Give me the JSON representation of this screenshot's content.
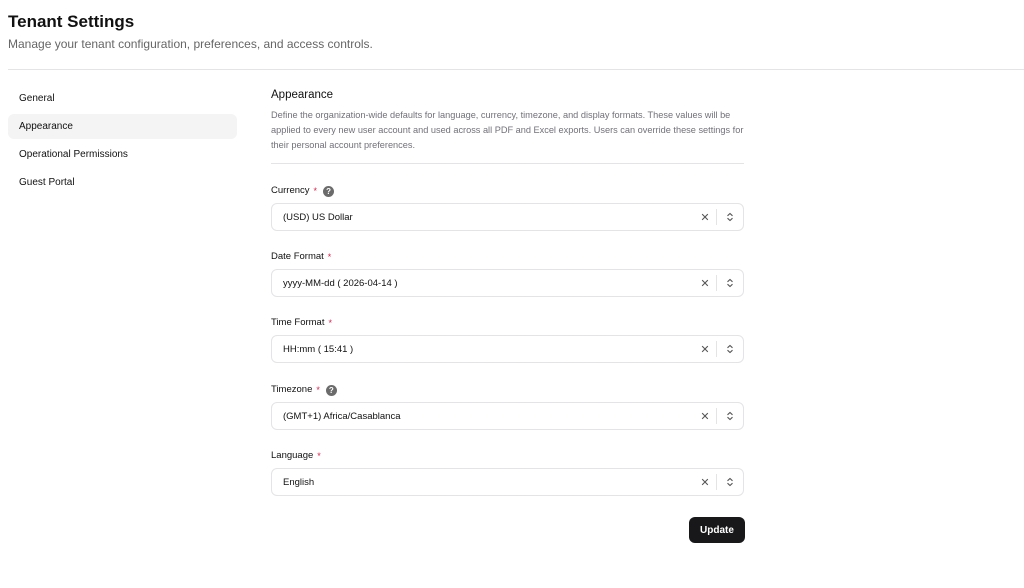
{
  "header": {
    "title": "Tenant Settings",
    "subtitle": "Manage your tenant configuration, preferences, and access controls."
  },
  "sidebar": {
    "items": [
      {
        "label": "General",
        "active": false
      },
      {
        "label": "Appearance",
        "active": true
      },
      {
        "label": "Operational Permissions",
        "active": false
      },
      {
        "label": "Guest Portal",
        "active": false
      }
    ]
  },
  "main": {
    "title": "Appearance",
    "description": "Define the organization-wide defaults for language, currency, timezone, and display formats. These values will be applied to every new user account and used across all PDF and Excel exports. Users can override these settings for their personal account preferences.",
    "fields": {
      "currency": {
        "label": "Currency",
        "required_mark": "*",
        "help_icon": "question-circle-icon",
        "value": "(USD) US Dollar"
      },
      "date_format": {
        "label": "Date Format",
        "required_mark": "*",
        "value": "yyyy-MM-dd ( 2026-04-14 )"
      },
      "time_format": {
        "label": "Time Format",
        "required_mark": "*",
        "value": "HH:mm ( 15:41 )"
      },
      "timezone": {
        "label": "Timezone",
        "required_mark": "*",
        "help_icon": "question-circle-icon",
        "value": "(GMT+1) Africa/Casablanca"
      },
      "language": {
        "label": "Language",
        "required_mark": "*",
        "value": "English"
      }
    },
    "help_glyph": "?",
    "clear_glyph": "✕",
    "update_label": "Update"
  },
  "colors": {
    "primary_button": "#18181b",
    "required": "#e11d48",
    "border": "#e4e4e7",
    "active_nav": "#f4f4f5"
  }
}
